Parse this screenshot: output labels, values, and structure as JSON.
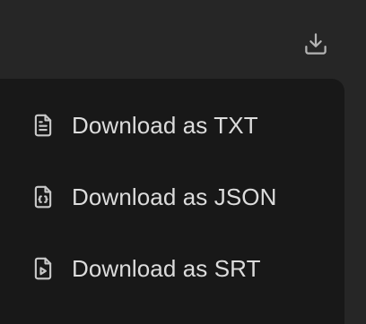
{
  "toolbar": {
    "download_icon": "download-icon"
  },
  "menu": {
    "items": [
      {
        "label": "Download as TXT",
        "icon": "file-text-icon"
      },
      {
        "label": "Download as JSON",
        "icon": "file-code-icon"
      },
      {
        "label": "Download as SRT",
        "icon": "file-video-icon"
      }
    ]
  },
  "colors": {
    "background": "#262626",
    "menu_background": "#181818",
    "text": "#dcdcdc",
    "icon": "#c8c8c8"
  }
}
